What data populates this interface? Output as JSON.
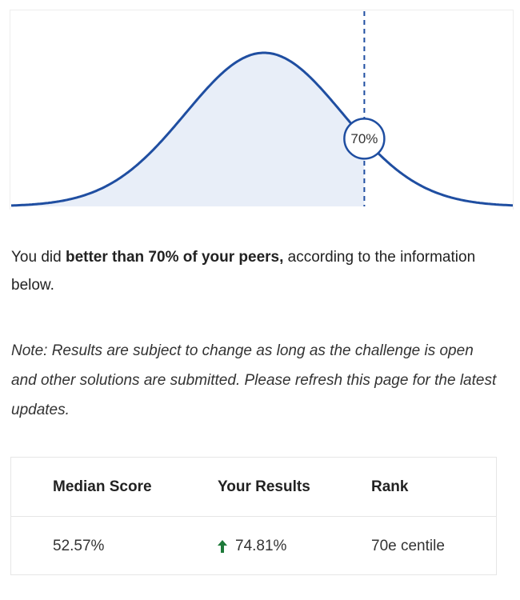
{
  "chart_data": {
    "type": "area",
    "percentile_label": "70%",
    "percentile": 70,
    "colors": {
      "curve": "#1f4ea1",
      "fill": "#e8eef8",
      "marker_line": "#1f4ea1",
      "marker_circle_fill": "#ffffff"
    }
  },
  "summary": {
    "prefix": "You did ",
    "bold": "better than 70% of your peers,",
    "suffix": " according to the information below."
  },
  "note": {
    "text": "Note: Results are subject to change as long as the challenge is open and other solutions are submitted. Please refresh this page for the latest updates."
  },
  "table": {
    "headers": [
      "Median Score",
      "Your Results",
      "Rank"
    ],
    "row": {
      "median": "52.57%",
      "result": "74.81%",
      "rank": "70e centile",
      "result_icon": "arrow-up-icon",
      "result_icon_color": "#1e7a3a"
    }
  }
}
